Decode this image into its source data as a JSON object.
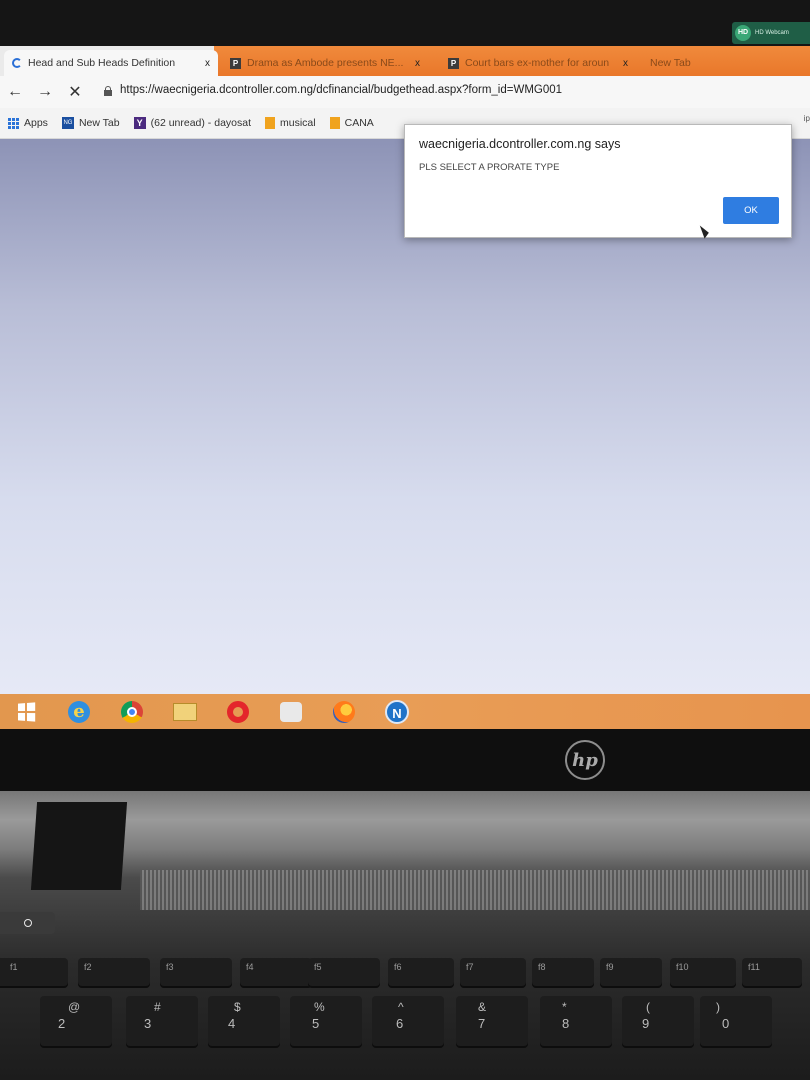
{
  "notification": {
    "badge": "HD",
    "text": "HD Webcam"
  },
  "browser": {
    "tabs": [
      {
        "label": "Head and Sub Heads Definition",
        "close": "x",
        "active": true
      },
      {
        "label": "Drama as Ambode presents NE...",
        "close": "x",
        "active": false
      },
      {
        "label": "Court bars ex-mother for aroun",
        "close": "x",
        "active": false
      },
      {
        "label": "New Tab",
        "close": "",
        "active": false
      }
    ],
    "nav": {
      "back": "←",
      "forward": "→",
      "stop": "✕"
    },
    "url": "https://waecnigeria.dcontroller.com.ng/dcfinancial/budgethead.aspx?form_id=WMG001",
    "bookmarks": [
      {
        "label": "Apps",
        "icon": "apps-icon"
      },
      {
        "label": "New Tab",
        "icon": "newtab-icon"
      },
      {
        "label": "(62 unread) - dayosat",
        "icon": "yahoo-icon"
      },
      {
        "label": "musical",
        "icon": "folder-icon"
      },
      {
        "label": "CANA",
        "icon": "folder-icon"
      }
    ],
    "bookmarks_more": "ip"
  },
  "dialog": {
    "title": "waecnigeria.dcontroller.com.ng says",
    "message": "PLS SELECT A PRORATE TYPE",
    "ok_label": "OK"
  },
  "taskbar": {
    "items": [
      "start-icon",
      "ie-icon",
      "chrome-icon",
      "file-explorer-icon",
      "opera-icon",
      "app-icon",
      "firefox-icon",
      "n-app-icon"
    ],
    "n_label": "N",
    "ie_label": "e"
  },
  "laptop": {
    "brand": "hp",
    "fn_keys": [
      {
        "label": "f1"
      },
      {
        "label": "f2"
      },
      {
        "label": "f3"
      },
      {
        "label": "f4"
      },
      {
        "label": "f5"
      },
      {
        "label": "f6"
      },
      {
        "label": "f7"
      },
      {
        "label": "f8"
      },
      {
        "label": "f9"
      },
      {
        "label": "f10"
      },
      {
        "label": "f11"
      }
    ],
    "num_keys": [
      {
        "top": "@",
        "bottom": "2"
      },
      {
        "top": "#",
        "bottom": "3"
      },
      {
        "top": "$",
        "bottom": "4"
      },
      {
        "top": "%",
        "bottom": "5"
      },
      {
        "top": "^",
        "bottom": "6"
      },
      {
        "top": "&",
        "bottom": "7"
      },
      {
        "top": "*",
        "bottom": "8"
      },
      {
        "top": "(",
        "bottom": "9"
      },
      {
        "top": ")",
        "bottom": "0"
      }
    ]
  }
}
